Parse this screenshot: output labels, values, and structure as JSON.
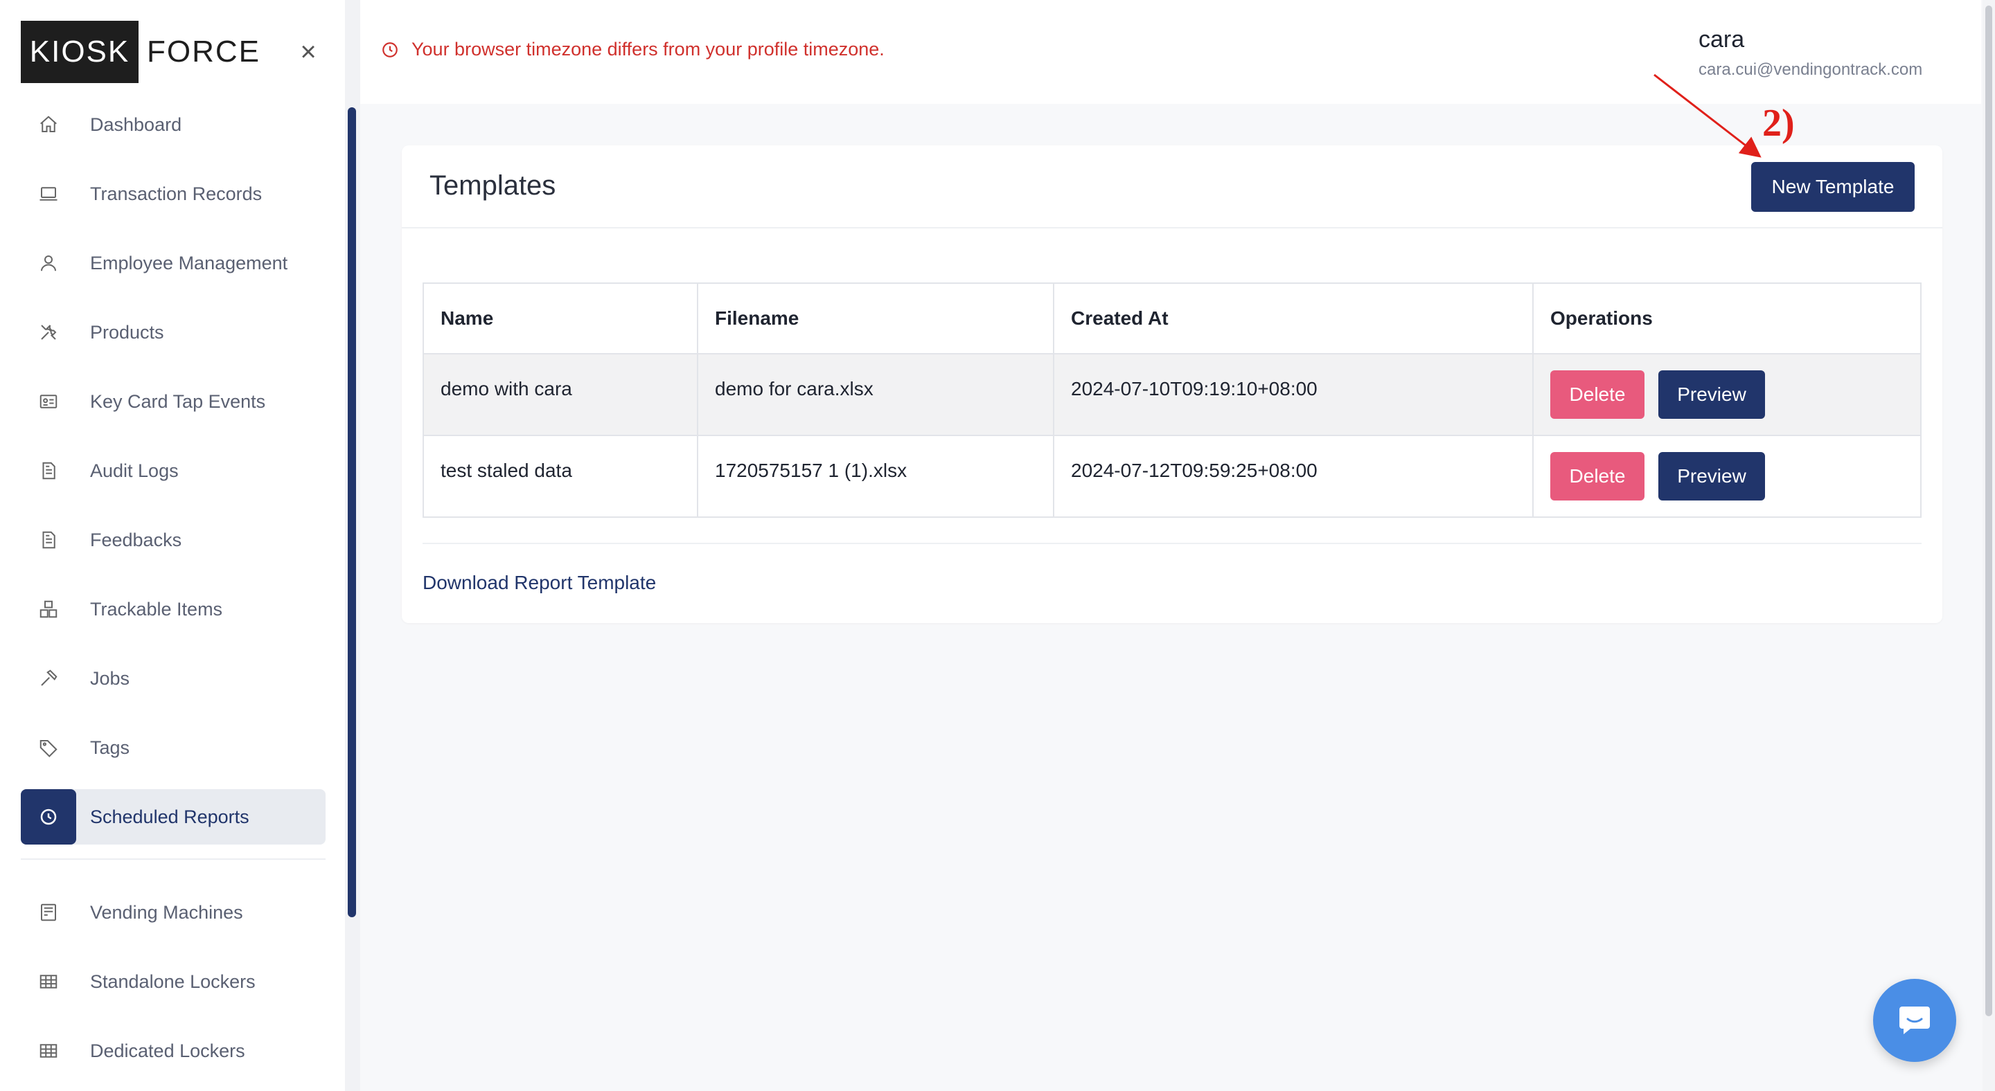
{
  "brand": {
    "logo_left": "KIOSK",
    "logo_right": "FORCE"
  },
  "sidebar": {
    "close_symbol": "×",
    "items": [
      {
        "label": "Dashboard",
        "icon": "home-icon"
      },
      {
        "label": "Transaction Records",
        "icon": "monitor-icon"
      },
      {
        "label": "Employee Management",
        "icon": "user-icon"
      },
      {
        "label": "Products",
        "icon": "tools-icon"
      },
      {
        "label": "Key Card Tap Events",
        "icon": "id-card-icon"
      },
      {
        "label": "Audit Logs",
        "icon": "document-icon"
      },
      {
        "label": "Feedbacks",
        "icon": "document-icon"
      },
      {
        "label": "Trackable Items",
        "icon": "boxes-icon"
      },
      {
        "label": "Jobs",
        "icon": "hammer-icon"
      },
      {
        "label": "Tags",
        "icon": "tag-icon"
      },
      {
        "label": "Scheduled Reports",
        "icon": "clock-icon",
        "active": true
      }
    ],
    "items_lower": [
      {
        "label": "Vending Machines",
        "icon": "machine-icon"
      },
      {
        "label": "Standalone Lockers",
        "icon": "grid-icon"
      },
      {
        "label": "Dedicated Lockers",
        "icon": "grid-icon"
      }
    ]
  },
  "header": {
    "timezone_warning": "Your browser timezone differs from your profile timezone.",
    "user_name": "cara",
    "user_email": "cara.cui@vendingontrack.com"
  },
  "templates": {
    "title": "Templates",
    "new_button": "New Template",
    "columns": [
      "Name",
      "Filename",
      "Created At",
      "Operations"
    ],
    "rows": [
      {
        "name": "demo with cara",
        "filename": "demo for cara.xlsx",
        "created_at": "2024-07-10T09:19:10+08:00"
      },
      {
        "name": "test staled data",
        "filename": "1720575157 1 (1).xlsx",
        "created_at": "2024-07-12T09:59:25+08:00"
      }
    ],
    "delete_label": "Delete",
    "preview_label": "Preview",
    "download_link": "Download Report Template"
  },
  "annotation": {
    "label": "2)"
  },
  "colors": {
    "primary": "#21356b",
    "danger": "#e85a7d",
    "warning": "#d0312d",
    "annotation": "#e0201a",
    "chat": "#4a8ee6"
  }
}
